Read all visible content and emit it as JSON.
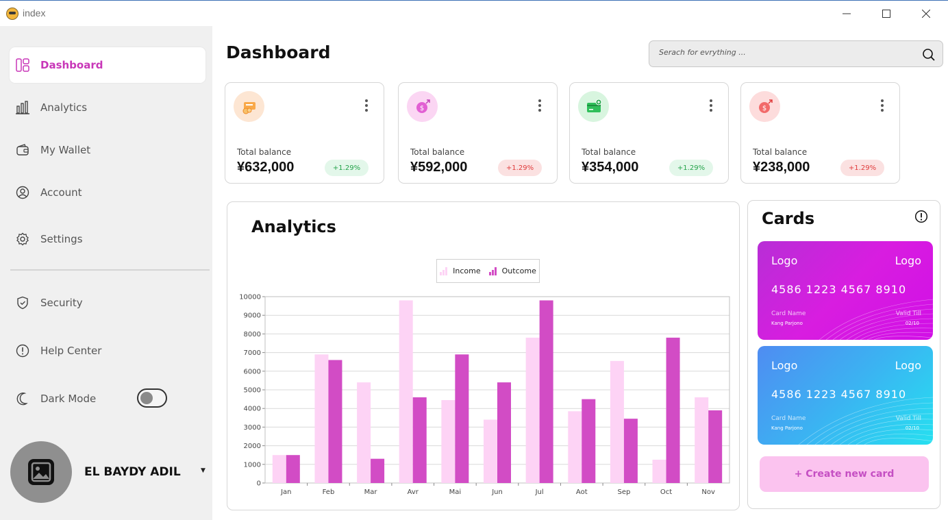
{
  "window": {
    "title": "index",
    "icons": {
      "app": "app-icon",
      "minimize": "minimize-icon",
      "maximize": "maximize-icon",
      "close": "close-icon"
    }
  },
  "sidebar": {
    "items": [
      {
        "label": "Dashboard",
        "icon": "dashboard-icon",
        "active": true
      },
      {
        "label": "Analytics",
        "icon": "bar-chart-icon",
        "active": false
      },
      {
        "label": "My Wallet",
        "icon": "wallet-icon",
        "active": false
      },
      {
        "label": "Account",
        "icon": "user-icon",
        "active": false
      },
      {
        "label": "Settings",
        "icon": "gear-icon",
        "active": false
      },
      {
        "label": "Security",
        "icon": "shield-icon",
        "active": false
      },
      {
        "label": "Help Center",
        "icon": "info-icon",
        "active": false
      },
      {
        "label": "Dark Mode",
        "icon": "moon-icon",
        "active": false
      }
    ],
    "dark_mode_on": false,
    "profile": {
      "name": "EL BAYDY ADIL",
      "icon": "image-placeholder-icon"
    },
    "accent_color": "#c837b8"
  },
  "header": {
    "title": "Dashboard",
    "search": {
      "placeholder": "Serach for evrything ...",
      "value": "",
      "icon": "search-icon"
    }
  },
  "stats": [
    {
      "label": "Total balance",
      "amount": "¥632,000",
      "change": "+1.29%",
      "trend": "up",
      "icon": "wallet-coins-icon",
      "icon_bg": "#fde6d3",
      "badge_bg": "#e3f7ea",
      "badge_color": "#24a34a"
    },
    {
      "label": "Total balance",
      "amount": "¥592,000",
      "change": "+1.29%",
      "trend": "down",
      "icon": "coin-send-icon",
      "icon_bg": "#fbd6f3",
      "badge_bg": "#fbe1e1",
      "badge_color": "#e03b3b"
    },
    {
      "label": "Total balance",
      "amount": "¥354,000",
      "change": "+1.29%",
      "trend": "up",
      "icon": "card-add-icon",
      "icon_bg": "#d8f5df",
      "badge_bg": "#e3f7ea",
      "badge_color": "#24a34a"
    },
    {
      "label": "Total balance",
      "amount": "¥238,000",
      "change": "+1.29%",
      "trend": "down",
      "icon": "coin-up-icon",
      "icon_bg": "#fddcdc",
      "badge_bg": "#fbe1e1",
      "badge_color": "#e03b3b"
    }
  ],
  "analytics": {
    "title": "Analytics"
  },
  "chart_data": {
    "type": "bar",
    "categories": [
      "Jan",
      "Feb",
      "Mar",
      "Avr",
      "Mai",
      "Jun",
      "Jul",
      "Aot",
      "Sep",
      "Oct",
      "Nov"
    ],
    "series": [
      {
        "name": "Income",
        "color": "#fdd3f5",
        "values": [
          1500,
          6900,
          5400,
          9800,
          4450,
          3400,
          7800,
          3850,
          6550,
          1250,
          4600
        ]
      },
      {
        "name": "Outcome",
        "color": "#d24cc5",
        "values": [
          1500,
          6600,
          1300,
          4600,
          6900,
          5400,
          9800,
          4500,
          3450,
          7800,
          3900
        ]
      }
    ],
    "yticks": [
      0,
      1000,
      2000,
      3000,
      4000,
      5000,
      6000,
      7000,
      8000,
      9000,
      10000
    ],
    "ylim": [
      0,
      10000
    ],
    "grid": true,
    "legend": "top-center"
  },
  "cards": {
    "title": "Cards",
    "info_icon": "info-icon",
    "items": [
      {
        "logo_left": "Logo",
        "logo_right": "Logo",
        "number": "4586 1223 4567 8910",
        "name_label": "Card Name",
        "name": "Kang Parjono",
        "valid_label": "Valid Till",
        "valid": "02/10",
        "theme": "magenta"
      },
      {
        "logo_left": "Logo",
        "logo_right": "Logo",
        "number": "4586 1223 4567 8910",
        "name_label": "Card Name",
        "name": "Kang Parjono",
        "valid_label": "Valid Till",
        "valid": "02/10",
        "theme": "cyan"
      }
    ],
    "create_label": "+ Create new card"
  }
}
